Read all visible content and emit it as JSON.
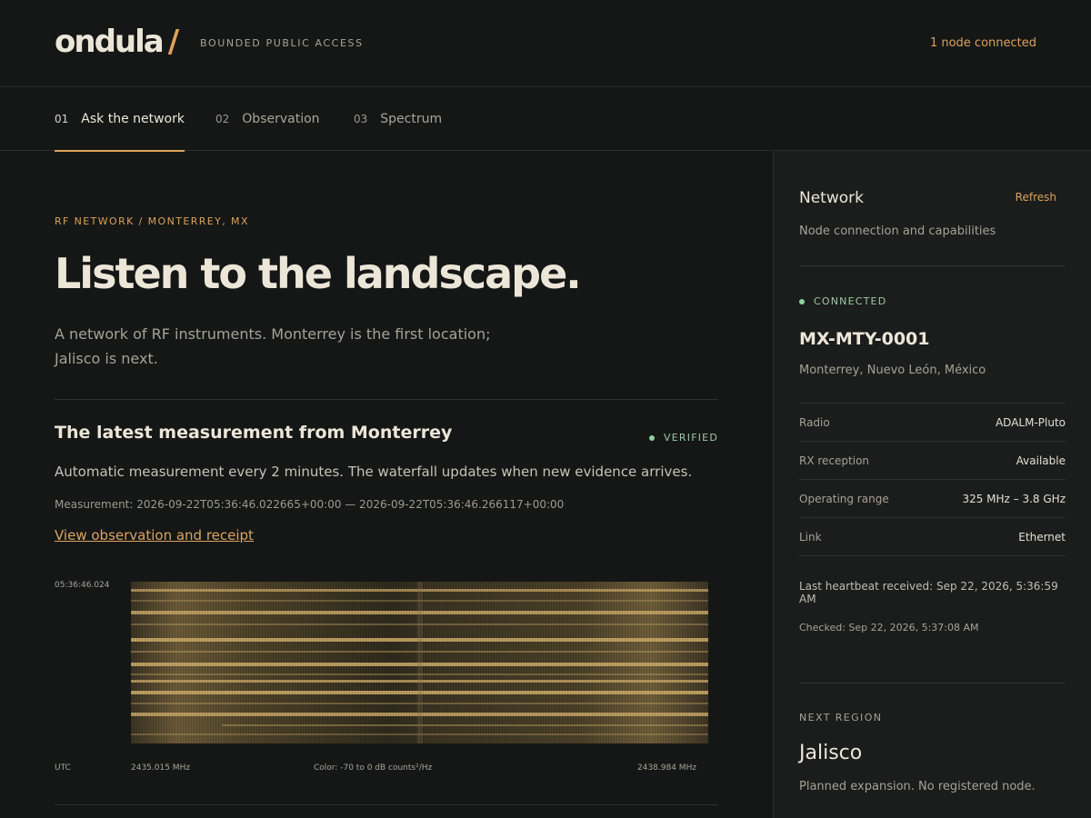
{
  "header": {
    "logo": "ondula",
    "logo_slash": "/",
    "access": "BOUNDED PUBLIC ACCESS",
    "node_status": "1 node connected"
  },
  "tabs": [
    {
      "num": "01",
      "label": "Ask the network",
      "active": true
    },
    {
      "num": "02",
      "label": "Observation",
      "active": false
    },
    {
      "num": "03",
      "label": "Spectrum",
      "active": false
    }
  ],
  "main": {
    "kicker": "RF NETWORK / MONTERREY, MX",
    "hero": "Listen to the landscape.",
    "intro": "A network of RF instruments. Monterrey is the first location; Jalisco is next.",
    "section_title": "The latest measurement from Monterrey",
    "verified": "VERIFIED",
    "description": "Automatic measurement every 2 minutes. The waterfall updates when new evidence arrives.",
    "measurement": "Measurement: 2026-09-22T05:36:46.022665+00:00 — 2026-09-22T05:36:46.266117+00:00",
    "link": "View observation and receipt"
  },
  "waterfall": {
    "timestamp": "05:36:46.024",
    "timezone": "UTC",
    "freq_start": "2435.015 MHz",
    "freq_end": "2438.984 MHz",
    "color_scale": "Color: -70 to 0 dB counts²/Hz"
  },
  "sidebar": {
    "title": "Network",
    "refresh": "Refresh",
    "subtitle": "Node connection and capabilities",
    "status": "CONNECTED",
    "node_id": "MX-MTY-0001",
    "location": "Monterrey, Nuevo León, México",
    "specs": [
      {
        "key": "Radio",
        "value": "ADALM-Pluto"
      },
      {
        "key": "RX reception",
        "value": "Available"
      },
      {
        "key": "Operating range",
        "value": "325 MHz – 3.8 GHz"
      },
      {
        "key": "Link",
        "value": "Ethernet"
      }
    ],
    "heartbeat": "Last heartbeat received: Sep 22, 2026, 5:36:59 AM",
    "checked": "Checked: Sep 22, 2026, 5:37:08 AM",
    "next_label": "NEXT REGION",
    "next_region": "Jalisco",
    "next_desc": "Planned expansion. No registered node."
  },
  "colors": {
    "accent": "#e0a25a",
    "status_green": "#8fd19e",
    "background": "#151716",
    "panel": "#1b1d1c"
  }
}
